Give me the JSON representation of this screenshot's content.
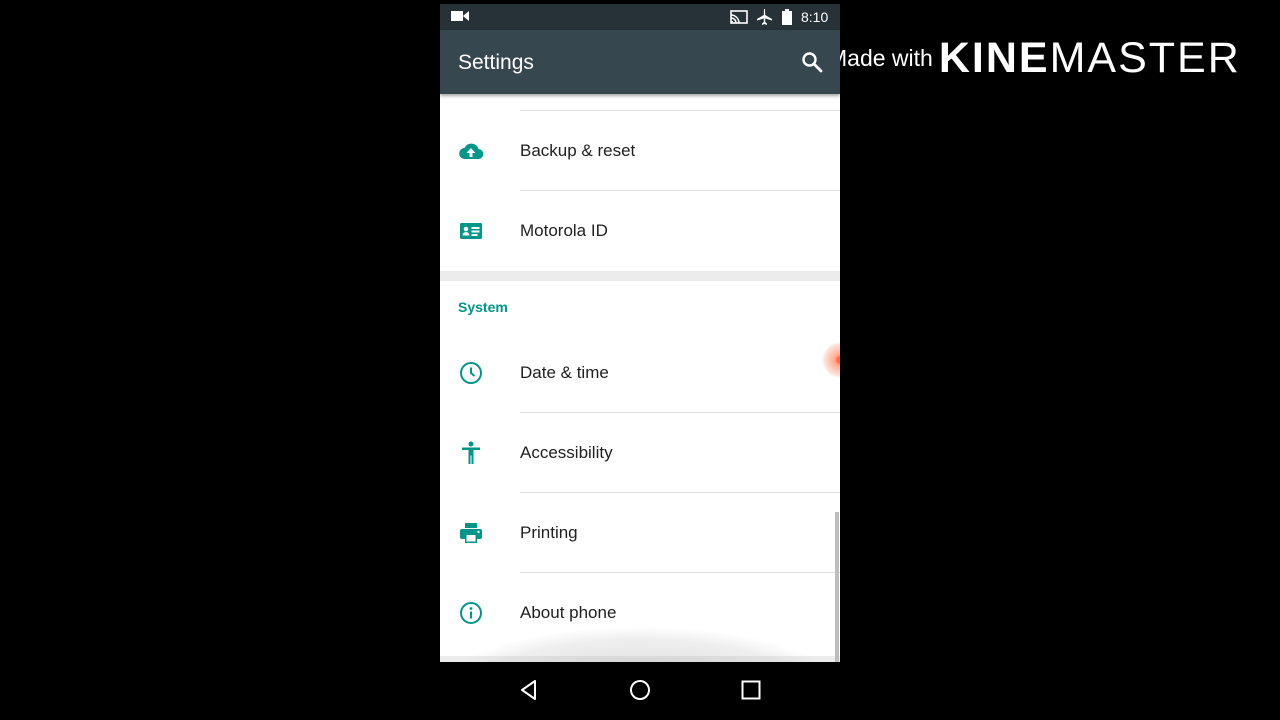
{
  "status_bar": {
    "time": "8:10",
    "icons": [
      "video-record-icon",
      "cast-icon",
      "airplane-mode-icon",
      "battery-icon"
    ]
  },
  "app_bar": {
    "title": "Settings",
    "search_icon": "search-icon"
  },
  "settings": {
    "personal_items": [
      {
        "label": "Backup & reset",
        "icon": "cloud-upload-icon"
      },
      {
        "label": "Motorola ID",
        "icon": "id-card-icon"
      }
    ],
    "system_section": {
      "header": "System",
      "items": [
        {
          "label": "Date & time",
          "icon": "clock-icon"
        },
        {
          "label": "Accessibility",
          "icon": "accessibility-icon"
        },
        {
          "label": "Printing",
          "icon": "printer-icon"
        },
        {
          "label": "About phone",
          "icon": "info-icon"
        }
      ]
    }
  },
  "nav_bar": {
    "buttons": [
      "back-icon",
      "home-icon",
      "recents-icon"
    ]
  },
  "watermark": {
    "made_with": "Made with",
    "brand_bold": "KINE",
    "brand_light": "MASTER"
  },
  "colors": {
    "accent": "#009688",
    "status_bar": "#263238",
    "app_bar": "#37474F",
    "touch_indicator": "#FF7043"
  }
}
